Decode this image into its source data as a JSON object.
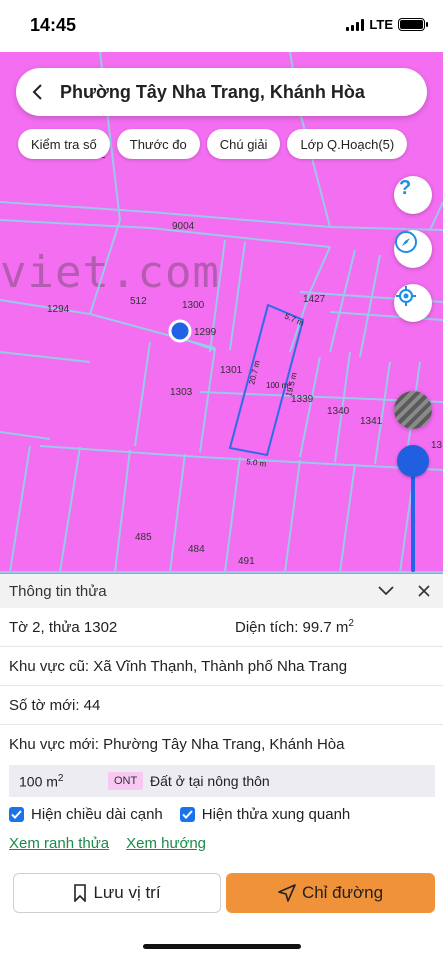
{
  "status": {
    "time": "14:45",
    "network": "LTE"
  },
  "search": {
    "title": "Phường Tây Nha Trang, Khánh Hòa"
  },
  "chips": [
    "Kiểm tra số",
    "Thước đo",
    "Chú giải",
    "Lớp Q.Hoạch(5)"
  ],
  "map": {
    "watermark": "viet.com",
    "colors": {
      "background": "#f36ef0",
      "lines": "#8fd3e8",
      "selected": "#2b6de8",
      "marker": "#2163e6"
    },
    "parcel_labels": [
      "9004",
      "1294",
      "512",
      "1300",
      "1427",
      "1299",
      "1301",
      "1303",
      "1339",
      "1340",
      "1341",
      "485",
      "484",
      "491",
      "2",
      "13"
    ],
    "edge_labels": [
      "5.7 m",
      "20.7 m",
      "100 m²",
      "19.5 m",
      "5.0 m"
    ],
    "icons": [
      "help-icon",
      "compass-icon",
      "locate-icon",
      "layer-icon"
    ]
  },
  "sheet": {
    "title": "Thông tin thửa",
    "parcel": "Tờ 2, thửa 1302",
    "area_label": "Diện tích: 99.7 m",
    "area_sup": "2",
    "old_area": "Khu vực cũ: Xã Vĩnh Thạnh, Thành phố Nha Trang",
    "new_sheet": "Số tờ mới: 44",
    "new_area": "Khu vực mới: Phường Tây Nha Trang, Khánh Hòa",
    "land": {
      "area": "100 m",
      "area_sup": "2",
      "code": "ONT",
      "description": "Đất ở tại nông thôn"
    },
    "checks": {
      "edge_length": "Hiện chiều dài cạnh",
      "surrounding": "Hiện thửa xung quanh"
    },
    "links": {
      "boundary": "Xem ranh thửa",
      "direction": "Xem hướng"
    },
    "buttons": {
      "save": "Lưu vị trí",
      "directions": "Chỉ đường"
    }
  }
}
